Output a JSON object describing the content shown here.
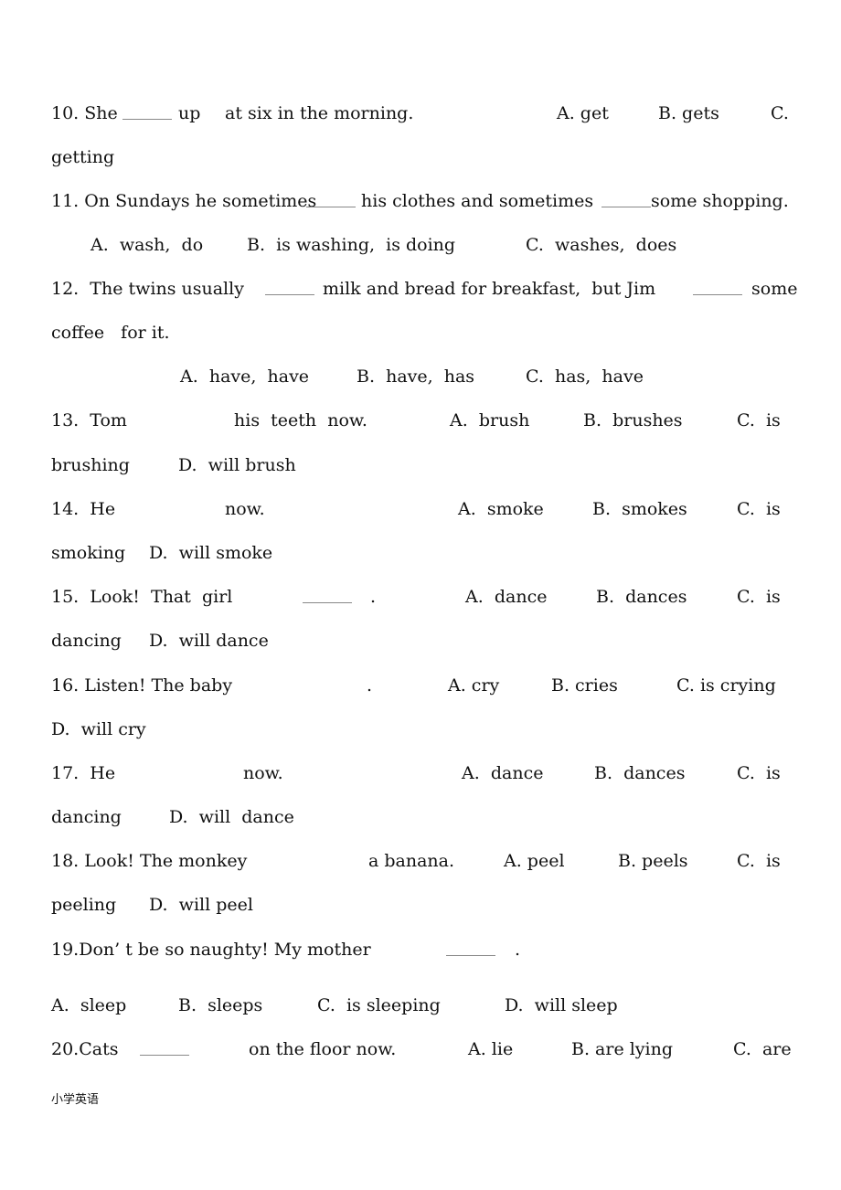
{
  "questions": [
    {
      "id": "q10",
      "lines": [
        {
          "frags": [
            "10. She",
            "up",
            "at six in the morning.",
            "A. get",
            "B. gets",
            "C."
          ]
        },
        {
          "frags": [
            "getting"
          ]
        }
      ]
    },
    {
      "id": "q11",
      "lines": [
        {
          "frags": [
            "11. On Sundays he sometimes",
            "his clothes and sometimes",
            "some shopping."
          ]
        },
        {
          "frags": [
            "A.  wash,  do",
            "B.  is washing,  is doing",
            "C.  washes,  does"
          ]
        }
      ]
    },
    {
      "id": "q12",
      "lines": [
        {
          "frags": [
            "12.  The twins usually",
            "milk and bread for breakfast,  but Jim",
            "some"
          ]
        },
        {
          "frags": [
            "coffee   for it."
          ]
        },
        {
          "frags": [
            "A.  have,  have",
            "B.  have,  has",
            "C.  has,  have"
          ]
        }
      ]
    },
    {
      "id": "q13",
      "lines": [
        {
          "frags": [
            "13.  Tom",
            "his  teeth  now.",
            "A.  brush",
            "B.  brushes",
            "C.  is"
          ]
        },
        {
          "frags": [
            "brushing",
            "D.  will brush"
          ]
        }
      ]
    },
    {
      "id": "q14",
      "lines": [
        {
          "frags": [
            "14.  He",
            "now.",
            "A.  smoke",
            "B.  smokes",
            "C.  is"
          ]
        },
        {
          "frags": [
            "smoking",
            "D.  will smoke"
          ]
        }
      ]
    },
    {
      "id": "q15",
      "lines": [
        {
          "frags": [
            "15.  Look!  That  girl",
            ".",
            "A.  dance",
            "B.  dances",
            "C.  is"
          ]
        },
        {
          "frags": [
            "dancing",
            "D.  will dance"
          ]
        }
      ]
    },
    {
      "id": "q16",
      "lines": [
        {
          "frags": [
            "16. Listen! The baby",
            ".",
            "A. cry",
            "B. cries",
            "C. is crying"
          ]
        },
        {
          "frags": [
            "D.  will cry"
          ]
        }
      ]
    },
    {
      "id": "q17",
      "lines": [
        {
          "frags": [
            "17.  He",
            "now.",
            "A.  dance",
            "B.  dances",
            "C.  is"
          ]
        },
        {
          "frags": [
            "dancing",
            "D.  will  dance"
          ]
        }
      ]
    },
    {
      "id": "q18",
      "lines": [
        {
          "frags": [
            "18. Look! The monkey",
            "a banana.",
            "A. peel",
            "B. peels",
            "C.  is"
          ]
        },
        {
          "frags": [
            "peeling",
            "D.  will peel"
          ]
        }
      ]
    },
    {
      "id": "q19",
      "lines": [
        {
          "frags": [
            "19.Don’ t be so naughty! My mother",
            "."
          ]
        },
        {
          "frags": [
            "A.  sleep",
            "B.  sleeps",
            "C.  is sleeping",
            "D.  will sleep"
          ]
        }
      ]
    },
    {
      "id": "q20",
      "lines": [
        {
          "frags": [
            "20.Cats",
            "on the floor now.",
            "A. lie",
            "B. are lying",
            "C.  are"
          ]
        }
      ]
    }
  ],
  "footer": "小学英语"
}
